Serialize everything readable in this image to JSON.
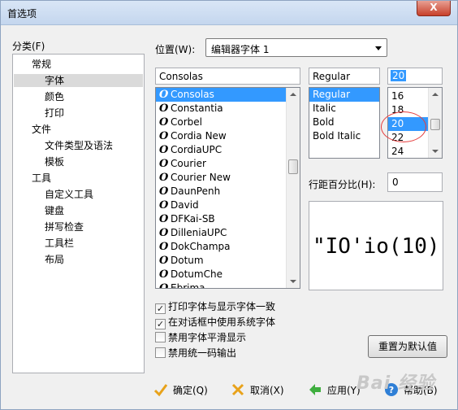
{
  "window": {
    "title": "首选项",
    "close_label": "X"
  },
  "category": {
    "label": "分类(F)",
    "items": [
      {
        "label": "常规",
        "level": 0
      },
      {
        "label": "字体",
        "level": 1,
        "selected": true
      },
      {
        "label": "颜色",
        "level": 1
      },
      {
        "label": "打印",
        "level": 1
      },
      {
        "label": "文件",
        "level": 0
      },
      {
        "label": "文件类型及语法",
        "level": 1
      },
      {
        "label": "模板",
        "level": 1
      },
      {
        "label": "工具",
        "level": 0
      },
      {
        "label": "自定义工具",
        "level": 1
      },
      {
        "label": "键盘",
        "level": 1
      },
      {
        "label": "拼写检查",
        "level": 1
      },
      {
        "label": "工具栏",
        "level": 1
      },
      {
        "label": "布局",
        "level": 1
      }
    ]
  },
  "location": {
    "label": "位置(W):",
    "value": "编辑器字体 1"
  },
  "font": {
    "name_value": "Consolas",
    "list": [
      "Consolas",
      "Constantia",
      "Corbel",
      "Cordia New",
      "CordiaUPC",
      "Courier",
      "Courier New",
      "DaunPenh",
      "David",
      "DFKai-SB",
      "DilleniaUPC",
      "DokChampa",
      "Dotum",
      "DotumChe",
      "Ebrima"
    ],
    "selected": "Consolas"
  },
  "style": {
    "value": "Regular",
    "list": [
      "Regular",
      "Italic",
      "Bold",
      "Bold Italic"
    ],
    "selected": "Regular"
  },
  "size": {
    "value": "20",
    "list": [
      "16",
      "18",
      "20",
      "22",
      "24"
    ],
    "selected": "20"
  },
  "line_spacing": {
    "label": "行距百分比(H):",
    "value": "0"
  },
  "preview": {
    "text": "\"IO'io(10)\""
  },
  "options": [
    {
      "label": "打印字体与显示字体一致",
      "checked": true
    },
    {
      "label": "在对话框中使用系统字体",
      "checked": true
    },
    {
      "label": "禁用字体平滑显示",
      "checked": false
    },
    {
      "label": "禁用统一码输出",
      "checked": false
    }
  ],
  "reset_button": "重置为默认值",
  "buttons": {
    "ok": "确定(Q)",
    "cancel": "取消(X)",
    "apply": "应用(Y)",
    "help": "帮助(B)"
  },
  "watermark": "Bai 经验"
}
